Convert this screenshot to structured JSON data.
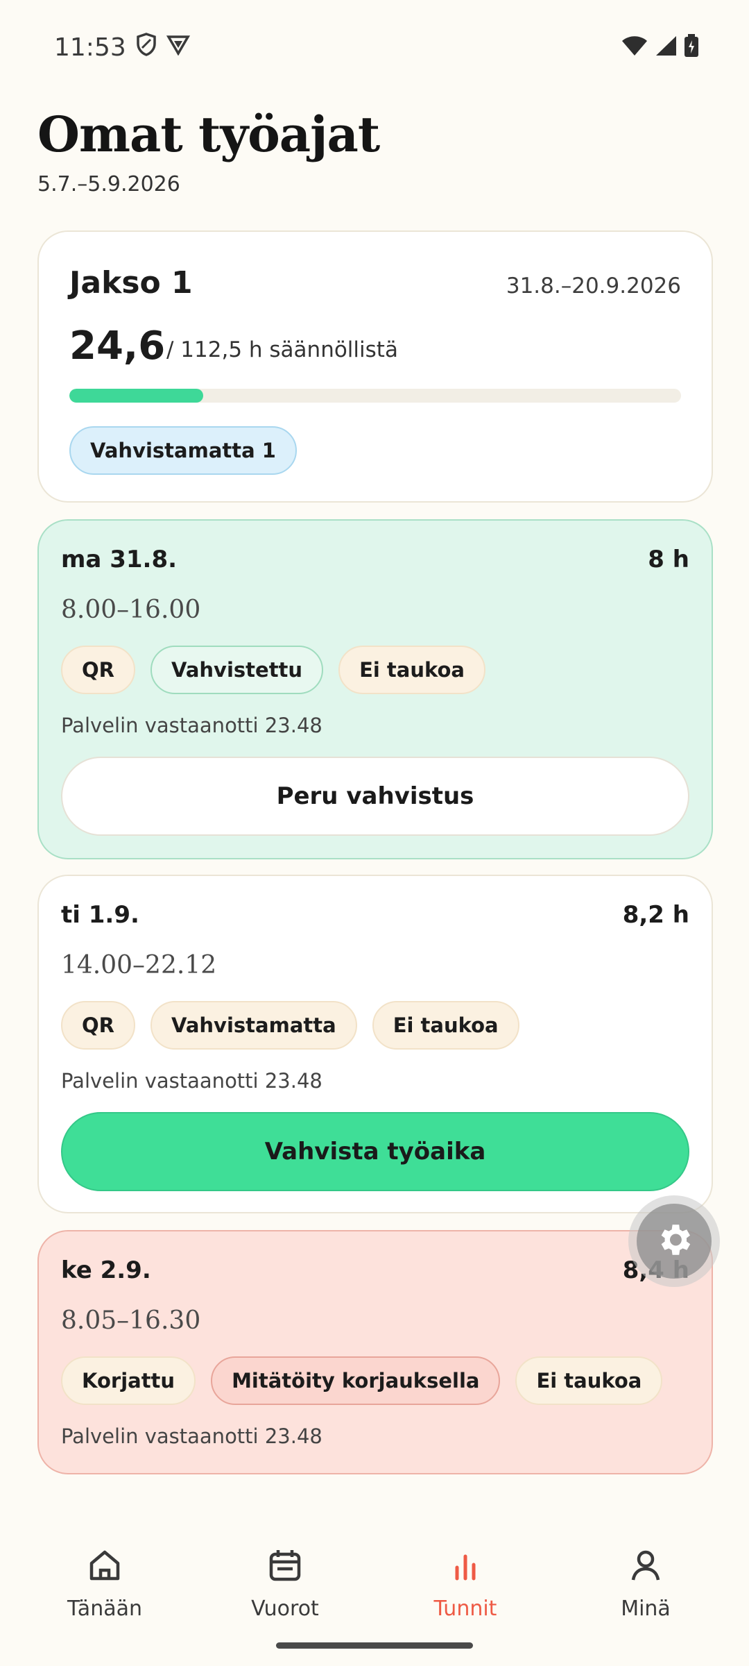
{
  "status_bar": {
    "time": "11:53"
  },
  "header": {
    "title": "Omat työajat",
    "date_range": "5.7.–5.9.2026"
  },
  "period": {
    "name": "Jakso 1",
    "dates": "31.8.–20.9.2026",
    "hours": "24,6",
    "total": "/ 112,5 h säännöllistä",
    "progress_fraction": 0.219,
    "badge": "Vahvistamatta 1"
  },
  "days": [
    {
      "label": "ma 31.8.",
      "hours": "8 h",
      "time": "8.00–16.00",
      "chips": [
        "QR",
        "Vahvistettu",
        "Ei taukoa"
      ],
      "note": "Palvelin vastaanotti 23.48",
      "button": "Peru vahvistus"
    },
    {
      "label": "ti 1.9.",
      "hours": "8,2 h",
      "time": "14.00–22.12",
      "chips": [
        "QR",
        "Vahvistamatta",
        "Ei taukoa"
      ],
      "note": "Palvelin vastaanotti 23.48",
      "button": "Vahvista työaika"
    },
    {
      "label": "ke 2.9.",
      "hours": "8,4 h",
      "time": "8.05–16.30",
      "chips": [
        "Korjattu",
        "Mitätöity korjauksella",
        "Ei taukoa"
      ],
      "note": "Palvelin vastaanotti 23.48"
    }
  ],
  "nav": [
    {
      "label": "Tänään",
      "icon": "home-icon"
    },
    {
      "label": "Vuorot",
      "icon": "calendar-icon"
    },
    {
      "label": "Tunnit",
      "icon": "bar-chart-icon",
      "active": true
    },
    {
      "label": "Minä",
      "icon": "person-icon"
    }
  ],
  "colors": {
    "accent_green": "#3fde97",
    "accent_red": "#ee5a45",
    "confirmed_bg": "#e0f6ec",
    "corrected_bg": "#fde2dc",
    "badge_blue": "#dcf0fb"
  }
}
